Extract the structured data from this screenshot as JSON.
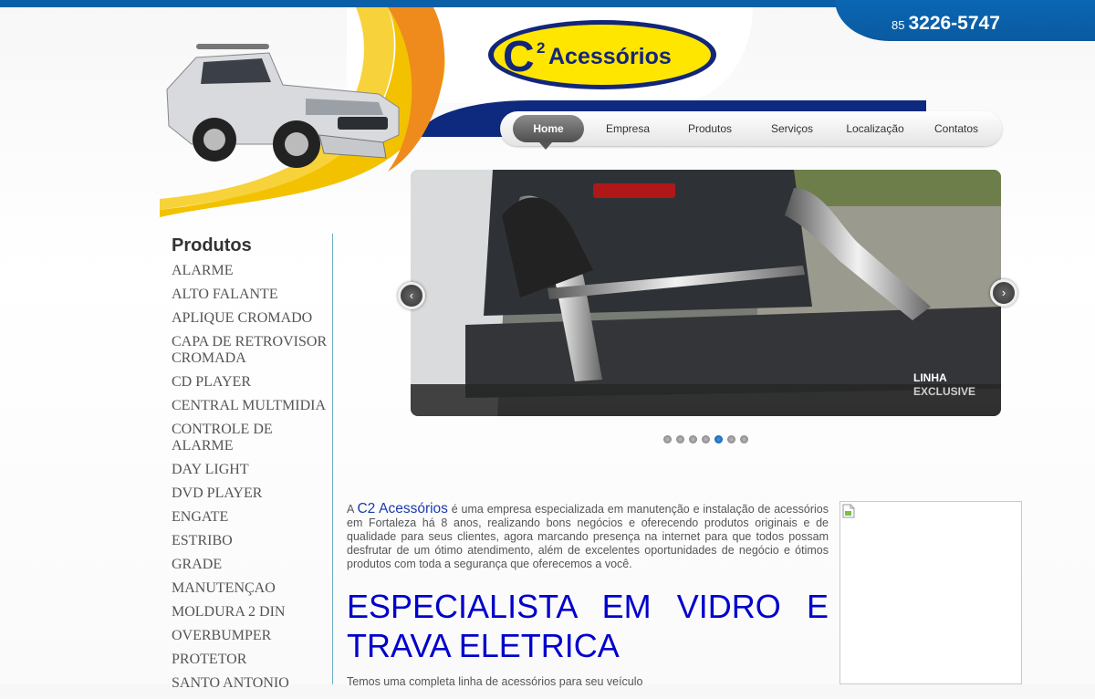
{
  "header": {
    "phone_area": "85",
    "phone_number": "3226-5747",
    "logo_prefix": "C",
    "logo_superscript": "2",
    "logo_word": "Acessórios"
  },
  "nav": {
    "items": [
      {
        "label": "Home",
        "active": true
      },
      {
        "label": "Empresa"
      },
      {
        "label": "Produtos"
      },
      {
        "label": "Serviços"
      },
      {
        "label": "Localização"
      },
      {
        "label": "Contatos"
      }
    ]
  },
  "slider": {
    "caption_line1": "LINHA",
    "caption_line2": "EXCLUSIVE",
    "total_slides": 7,
    "active_slide": 5
  },
  "sidebar": {
    "title": "Produtos",
    "items": [
      "ALARME",
      "ALTO FALANTE",
      "APLIQUE CROMADO",
      "CAPA DE RETROVISOR CROMADA",
      "CD PLAYER",
      "CENTRAL MULTMIDIA",
      "CONTROLE DE ALARME",
      "DAY LIGHT",
      "DVD PLAYER",
      "ENGATE",
      "ESTRIBO",
      "GRADE",
      "MANUTENÇAO",
      "MOLDURA 2 DIN",
      "OVERBUMPER",
      "PROTETOR",
      "SANTO ANTONIO"
    ]
  },
  "content": {
    "intro_prefix": "A ",
    "intro_brand": "C2 Acessórios",
    "intro_text": " é uma empresa especializada em manutenção e instalação de acessórios em Fortaleza há 8 anos, realizando bons negócios e oferecendo produtos originais e de qualidade para seus clientes, agora marcando presença na internet para que todos possam desfrutar de um ótimo atendimento, além de excelentes oportunidades de negócio e ótimos produtos com toda a segurança que oferecemos a você.",
    "headline": "ESPECIALISTA EM VIDRO E TRAVA ELETRICA",
    "more_text": "Temos uma completa linha de acessórios para seu veículo"
  },
  "colors": {
    "brand_blue": "#0a5fa6",
    "navy": "#0e2a7e",
    "headline_blue": "#0000cc",
    "logo_yellow": "#ffe600"
  }
}
